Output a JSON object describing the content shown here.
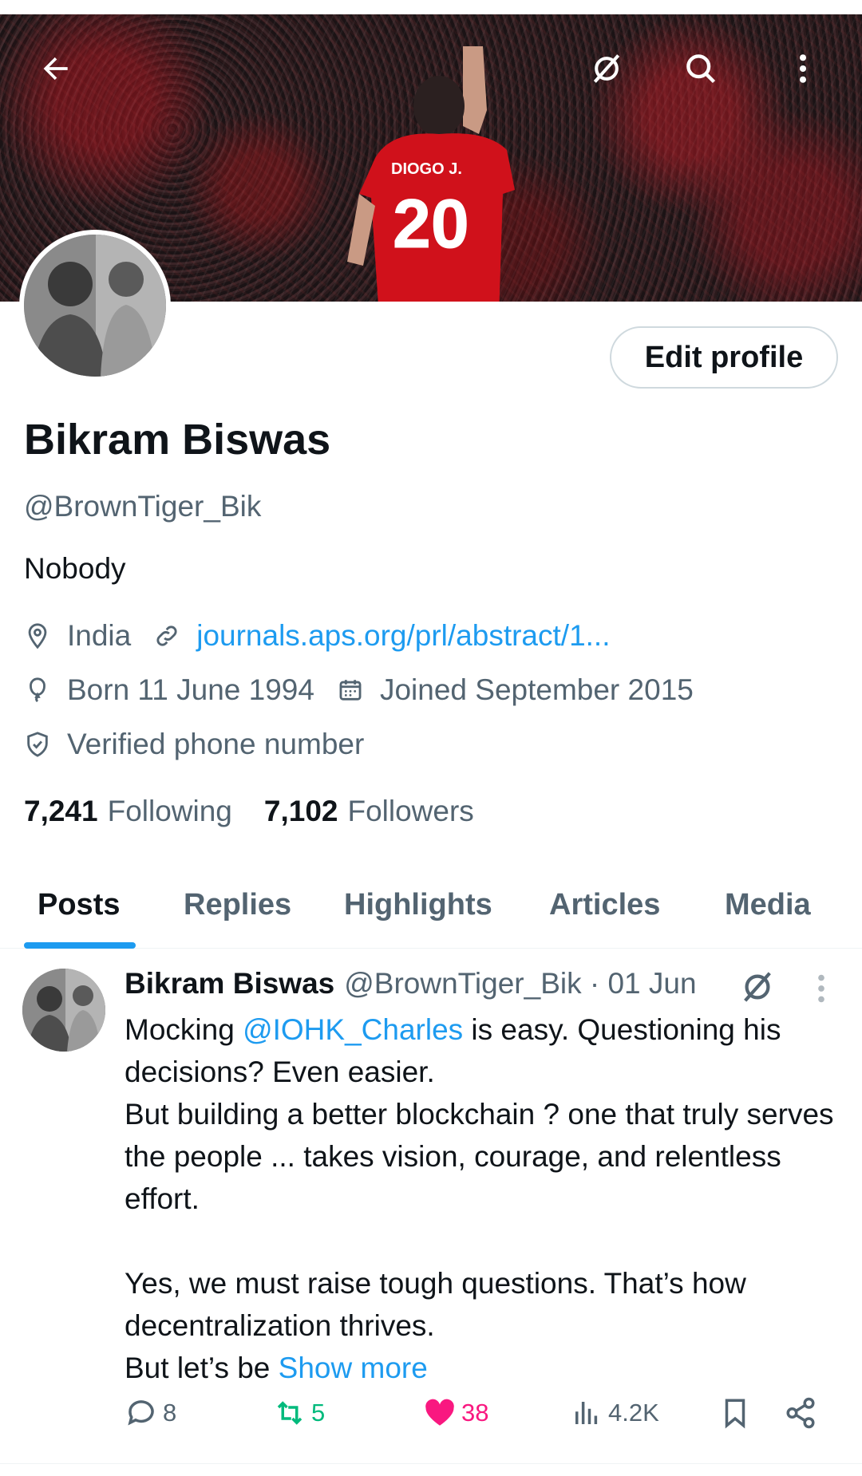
{
  "header": {
    "back_icon": "back-arrow-icon",
    "grok_icon": "grok-icon",
    "search_icon": "search-icon",
    "more_icon": "more-vertical-icon",
    "banner_jersey_name": "DIOGO J.",
    "banner_jersey_number": "20"
  },
  "profile": {
    "name": "Bikram Biswas",
    "handle": "@BrownTiger_Bik",
    "bio": "Nobody",
    "location": "India",
    "website": "journals.aps.org/prl/abstract/1...",
    "birth": "Born 11 June 1994",
    "joined": "Joined September 2015",
    "verified": "Verified phone number",
    "edit_label": "Edit profile",
    "following_count": "7,241",
    "following_label": "Following",
    "followers_count": "7,102",
    "followers_label": "Followers"
  },
  "tabs": [
    {
      "label": "Posts",
      "active": true
    },
    {
      "label": "Replies"
    },
    {
      "label": "Highlights"
    },
    {
      "label": "Articles"
    },
    {
      "label": "Media"
    }
  ],
  "post": {
    "author": "Bikram Biswas",
    "handle_date": "@BrownTiger_Bik · 01 Jun",
    "line1_pre": "Mocking ",
    "mention": "@IOHK_Charles",
    "line1_post": " is easy. Questioning his decisions? Even easier.",
    "line2": "But building a better blockchain ? one that truly serves the people ... takes vision, courage, and relentless effort.",
    "line3": "Yes, we must raise tough questions. That’s how decentralization thrives.",
    "line4_pre": "But let’s be ",
    "show_more": "Show more",
    "replies": "8",
    "reposts": "5",
    "likes": "38",
    "views": "4.2K"
  },
  "colors": {
    "accent": "#1d9bf0",
    "text": "#0f1419",
    "secondary": "#536471",
    "repost": "#00ba7c",
    "like": "#f91880"
  }
}
